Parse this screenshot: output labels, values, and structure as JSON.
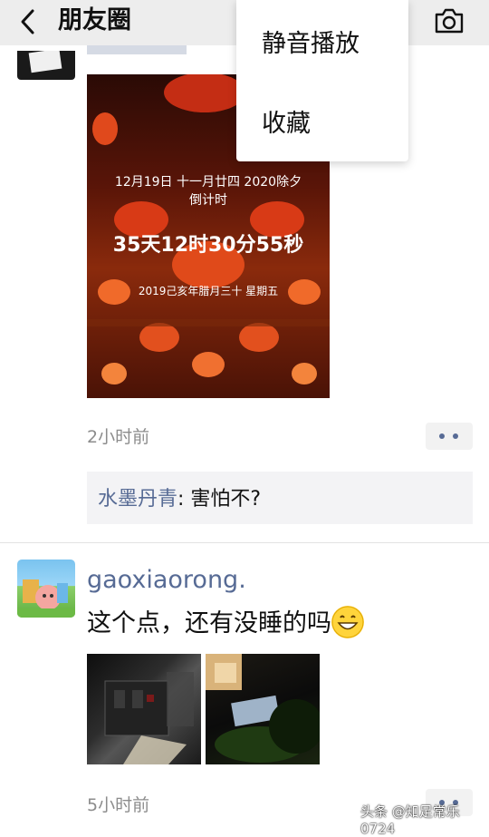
{
  "header": {
    "title": "朋友圈",
    "back_icon": "chevron-left-icon",
    "camera_icon": "camera-icon"
  },
  "popup_menu": {
    "items": [
      {
        "label": "静音播放"
      },
      {
        "label": "收藏"
      }
    ]
  },
  "posts": [
    {
      "image_text": {
        "line1": "12月19日  十一月廿四  2020除夕",
        "line2": "倒计时",
        "countdown": "35天12时30分55秒",
        "line4": "2019己亥年腊月三十  星期五"
      },
      "time": "2小时前",
      "comment": {
        "author": "水墨丹青",
        "text": ": 害怕不?"
      }
    },
    {
      "author": "gaoxiaorong.",
      "text": "这个点，还有没睡的吗",
      "emoji": "grinning-face-emoji",
      "time": "5小时前"
    }
  ],
  "watermark": "头条 @知足常乐0724",
  "colors": {
    "header_bg": "#ededed",
    "name_blue": "#576b95",
    "time_gray": "#8c8c8c",
    "comment_bg": "#f3f3f5"
  }
}
